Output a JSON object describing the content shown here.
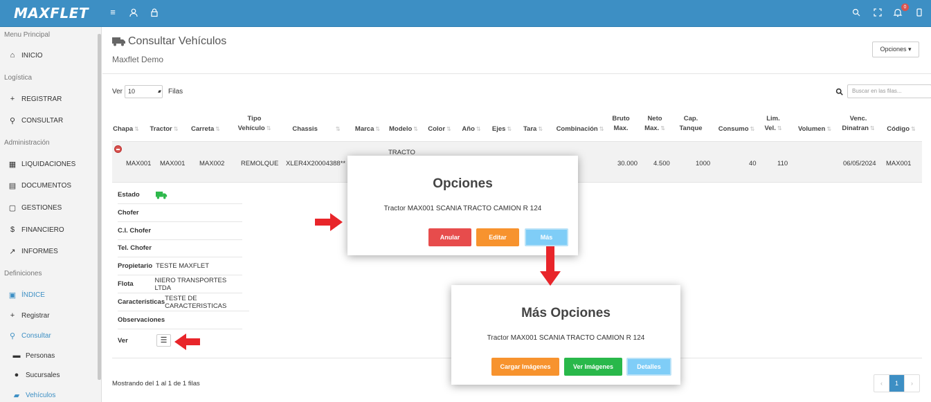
{
  "app": {
    "logo": "MAXFLET",
    "notifications": "0"
  },
  "sidebar": {
    "sections": [
      "Menu Principal",
      "Logística",
      "Administración",
      "Definiciones"
    ],
    "items": [
      {
        "label": "INICIO"
      },
      {
        "label": "REGISTRAR"
      },
      {
        "label": "CONSULTAR"
      },
      {
        "label": "LIQUIDACIONES"
      },
      {
        "label": "DOCUMENTOS"
      },
      {
        "label": "GESTIONES"
      },
      {
        "label": "FINANCIERO"
      },
      {
        "label": "INFORMES"
      },
      {
        "label": "ÍNDICE"
      },
      {
        "label": "Registrar"
      },
      {
        "label": "Consultar"
      },
      {
        "label": "Personas"
      },
      {
        "label": "Sucursales"
      },
      {
        "label": "Vehículos"
      }
    ]
  },
  "page": {
    "title": "Consultar Vehículos",
    "subtitle": "Maxflet Demo",
    "options_label": "Opciones ▾"
  },
  "controls": {
    "ver": "Ver",
    "rows_value": "10",
    "filas": "Filas",
    "search_placeholder": "Buscar en las filas..."
  },
  "table": {
    "headers": [
      "Chapa",
      "Tractor",
      "Carreta",
      "Tipo\nVehículo",
      "Chassis",
      "Marca",
      "Modelo",
      "Color",
      "Año",
      "Ejes",
      "Tara",
      "Combinación",
      "Bruto\nMax.",
      "Neto\nMax.",
      "Cap.\nTanque",
      "Consumo",
      "Lim.\nVel.",
      "Volumen",
      "Venc.\nDinatran",
      "Código"
    ],
    "row": {
      "chapa": "MAX001",
      "tractor": "MAX001",
      "carreta": "MAX002",
      "tipo": "REMOLQUE",
      "chassis": "XLER4X20004388**",
      "modelo": "TRACTO",
      "bruto": "30.000",
      "neto": "4.500",
      "cap": "1000",
      "consumo": "40",
      "lim": "110",
      "venc": "06/05/2024",
      "codigo": "MAX001"
    },
    "detail": [
      {
        "label": "Estado",
        "value": ""
      },
      {
        "label": "Chofer",
        "value": ""
      },
      {
        "label": "C.I. Chofer",
        "value": ""
      },
      {
        "label": "Tel. Chofer",
        "value": ""
      },
      {
        "label": "Propietario",
        "value": "TESTE MAXFLET"
      },
      {
        "label": "Flota",
        "value": "NIERO TRANSPORTES LTDA"
      },
      {
        "label": "Características",
        "value": "TESTE DE CARACTERISTICAS"
      },
      {
        "label": "Observaciones",
        "value": ""
      },
      {
        "label": "Ver",
        "value": ""
      }
    ],
    "showing": "Mostrando del 1 al 1 de 1 filas",
    "page": "1"
  },
  "modal1": {
    "title": "Opciones",
    "text": "Tractor MAX001 SCANIA TRACTO CAMION R 124",
    "buttons": [
      "Anular",
      "Editar",
      "Más"
    ]
  },
  "modal2": {
    "title": "Más Opciones",
    "text": "Tractor MAX001 SCANIA TRACTO CAMION R 124",
    "buttons": [
      "Cargar Imágenes",
      "Ver Imágenes",
      "Detalles"
    ]
  },
  "colors": {
    "accent": "#3d8fc4",
    "danger": "#e74c4c",
    "warning": "#f7932e",
    "info": "#7fcdf7",
    "success": "#29b84a"
  }
}
